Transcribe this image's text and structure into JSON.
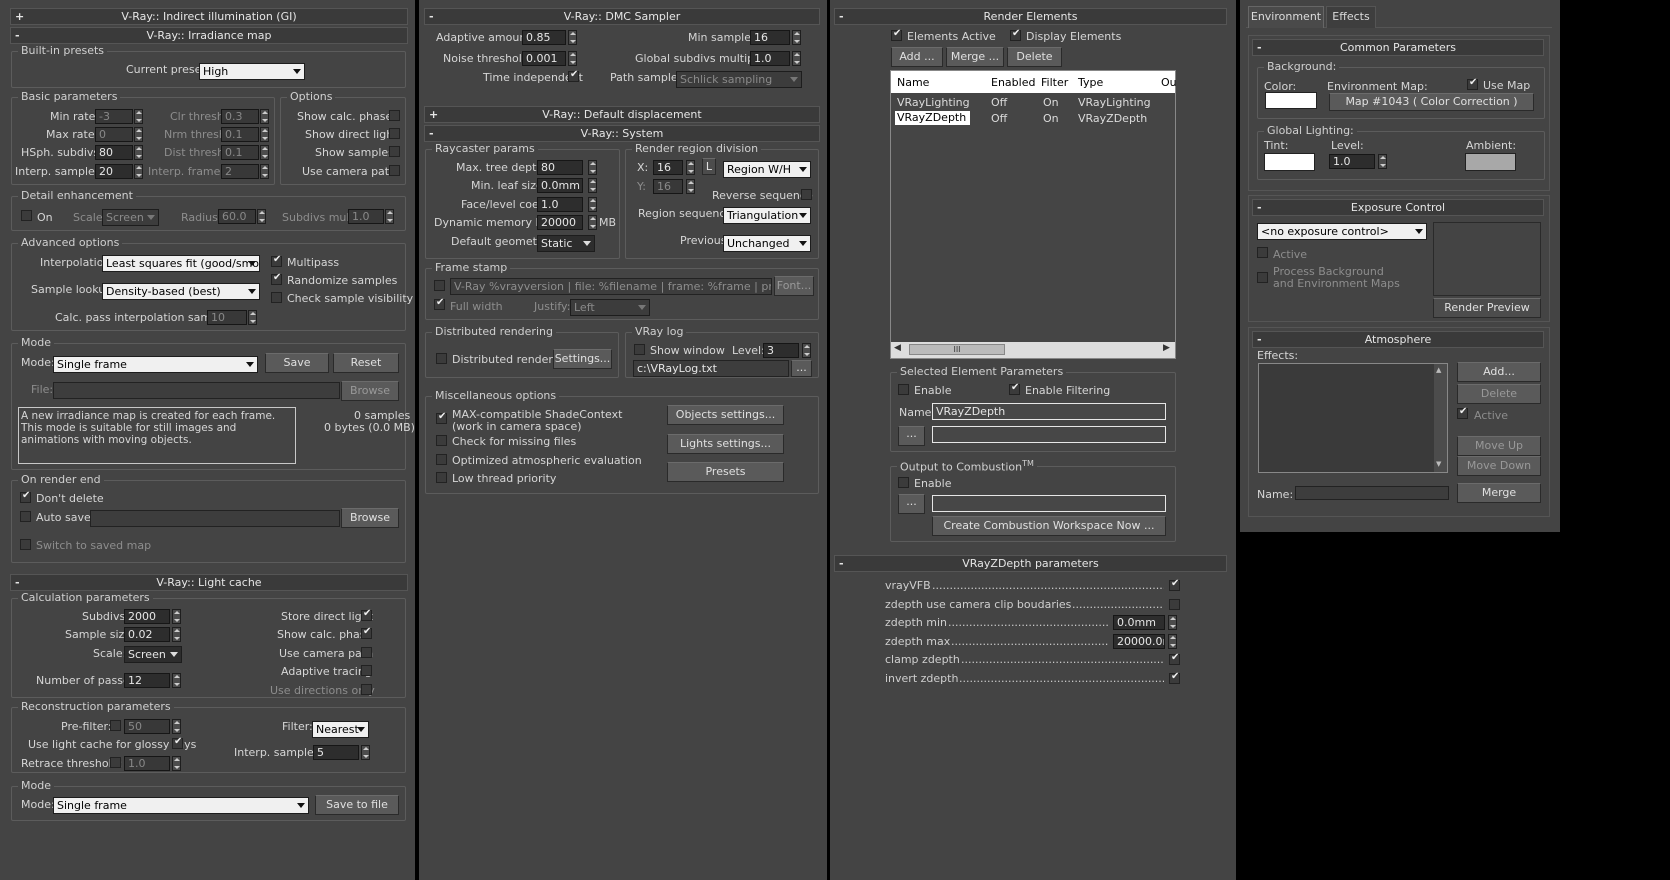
{
  "gi": {
    "title": "V-Ray:: Indirect illumination (GI)",
    "sign": "+"
  },
  "irr": {
    "title": "V-Ray:: Irradiance map",
    "sign": "-",
    "presets": {
      "label": "Built-in presets",
      "current_label": "Current preset:",
      "current": "High"
    },
    "basic": {
      "label": "Basic parameters",
      "min_rate_l": "Min rate:",
      "min_rate": "-3",
      "max_rate_l": "Max rate:",
      "max_rate": "0",
      "hsph_l": "HSph. subdivs:",
      "hsph": "80",
      "interp_l": "Interp. samples:",
      "interp": "20",
      "clr_l": "Clr thresh:",
      "clr": "0.3",
      "nrm_l": "Nrm thresh:",
      "nrm": "0.1",
      "dist_l": "Dist thresh:",
      "dist": "0.1",
      "frames_l": "Interp. frames:",
      "frames": "2"
    },
    "options": {
      "label": "Options",
      "show_calc": "Show calc. phase",
      "show_direct": "Show direct light",
      "show_samples": "Show samples",
      "use_cam": "Use camera path"
    },
    "detail": {
      "label": "Detail enhancement",
      "on": "On",
      "scale_l": "Scale:",
      "scale": "Screen",
      "radius_l": "Radius:",
      "radius": "60.0",
      "subdivs_l": "Subdivs mult.",
      "subdivs": "1.0"
    },
    "adv": {
      "label": "Advanced options",
      "interp_l": "Interpolation",
      "interp": "Least squares fit (good/smooth",
      "lookup_l": "Sample lookup:",
      "lookup": "Density-based (best)",
      "calc_l": "Calc. pass interpolation samples:",
      "calc": "10",
      "multipass": "Multipass",
      "randomize": "Randomize samples",
      "check_vis": "Check sample visibility"
    },
    "mode": {
      "label": "Mode",
      "mode_l": "Mode:",
      "mode": "Single frame",
      "save": "Save",
      "reset": "Reset",
      "file_l": "File:",
      "browse": "Browse",
      "desc": "A new irradiance map is created for each frame.\nThis mode is suitable for still images and animations with moving objects.",
      "samples": "0 samples",
      "bytes": "0 bytes (0.0 MB)"
    },
    "end": {
      "label": "On render end",
      "dont_delete": "Don't delete",
      "auto_save": "Auto save:",
      "browse": "Browse",
      "switch": "Switch to saved map"
    }
  },
  "lc": {
    "title": "V-Ray:: Light cache",
    "sign": "-",
    "calc": {
      "label": "Calculation parameters",
      "subdivs_l": "Subdivs:",
      "subdivs": "2000",
      "size_l": "Sample size:",
      "size": "0.02",
      "scale_l": "Scale:",
      "scale": "Screen",
      "passes_l": "Number of passes:",
      "passes": "12",
      "store_direct": "Store direct light",
      "show_calc": "Show calc. phase",
      "use_cam": "Use camera path",
      "adaptive": "Adaptive tracing",
      "use_dir": "Use directions only"
    },
    "recon": {
      "label": "Reconstruction parameters",
      "prefilter_l": "Pre-filter:",
      "prefilter": "50",
      "glossy": "Use light cache for glossy rays",
      "retrace_l": "Retrace threshold:",
      "retrace": "1.0",
      "filter_l": "Filter:",
      "filter": "Nearest",
      "interp_l": "Interp. samples:",
      "interp": "5"
    },
    "mode": {
      "label": "Mode",
      "mode_l": "Mode:",
      "mode": "Single frame",
      "save": "Save to file"
    }
  },
  "dmc": {
    "title": "V-Ray:: DMC Sampler",
    "sign": "-",
    "adaptive_l": "Adaptive amount:",
    "adaptive": "0.85",
    "noise_l": "Noise threshold:",
    "noise": "0.001",
    "time_l": "Time independent",
    "min_l": "Min samples:",
    "min": "16",
    "global_l": "Global subdivs multiplier:",
    "global": "1.0",
    "path_l": "Path sampler:",
    "path": "Schlick sampling"
  },
  "disp": {
    "title": "V-Ray:: Default displacement",
    "sign": "+"
  },
  "sys": {
    "title": "V-Ray:: System",
    "sign": "-",
    "ray": {
      "label": "Raycaster params",
      "depth_l": "Max. tree depth:",
      "depth": "80",
      "leaf_l": "Min. leaf size:",
      "leaf": "0.0mm",
      "face_l": "Face/level coef.",
      "face": "1.0",
      "mem_l": "Dynamic memory limit:",
      "mem": "20000",
      "mb": "MB",
      "geom_l": "Default geometry:",
      "geom": "Static"
    },
    "region": {
      "label": "Render region division",
      "x_l": "X:",
      "x": "16",
      "y_l": "Y:",
      "y": "16",
      "l": "L",
      "div": "Region W/H",
      "reverse": "Reverse sequence",
      "seq_l": "Region sequence:",
      "seq": "Triangulation",
      "prev_l": "Previous",
      "prev": "Unchanged"
    },
    "stamp": {
      "label": "Frame stamp",
      "text": "V-Ray %vrayversion | file: %filename | frame: %frame | primitives: %",
      "font": "Font...",
      "full": "Full width",
      "justify_l": "Justify:",
      "justify": "Left"
    },
    "dist": {
      "label": "Distributed rendering",
      "check": "Distributed rendering",
      "settings": "Settings..."
    },
    "log": {
      "label": "VRay log",
      "show": "Show window",
      "level_l": "Level:",
      "level": "3",
      "path": "c:\\VRayLog.txt",
      "more": "..."
    },
    "misc": {
      "label": "Miscellaneous options",
      "maxcompat": "MAX-compatible ShadeContext",
      "maxcompat2": "(work in camera space)",
      "missing": "Check for missing files",
      "optimized": "Optimized atmospheric evaluation",
      "low": "Low thread priority",
      "objects": "Objects settings...",
      "lights": "Lights settings...",
      "presets": "Presets"
    }
  },
  "re": {
    "title": "Render Elements",
    "sign": "-",
    "active": "Elements Active",
    "display": "Display Elements",
    "add": "Add ...",
    "merge": "Merge ...",
    "delete": "Delete",
    "columns": [
      "Name",
      "Enabled",
      "Filter",
      "Type",
      "Ou"
    ],
    "rows": [
      [
        "VRayLighting",
        "Off",
        "On",
        "VRayLighting"
      ],
      [
        "VRayZDepth",
        "Off",
        "On",
        "VRayZDepth"
      ]
    ],
    "scroll": "III",
    "sel": {
      "label": "Selected Element Parameters",
      "enable": "Enable",
      "filtering": "Enable Filtering",
      "name_l": "Name:",
      "name": "VRayZDepth",
      "dots": "..."
    },
    "comb": {
      "label": "Output to Combustion",
      "tm": "TM",
      "enable": "Enable",
      "dots": "...",
      "create": "Create Combustion Workspace Now ..."
    }
  },
  "zd": {
    "title": "VRayZDepth parameters",
    "sign": "-",
    "rows": [
      {
        "label": "vrayVFB",
        "kind": "check",
        "on": true
      },
      {
        "label": "zdepth use camera clip boudaries",
        "kind": "check",
        "on": false
      },
      {
        "label": "zdepth min",
        "kind": "num",
        "value": "0.0mm"
      },
      {
        "label": "zdepth max",
        "kind": "num",
        "value": "20000.0m"
      },
      {
        "label": "clamp zdepth",
        "kind": "check",
        "on": true
      },
      {
        "label": "invert zdepth",
        "kind": "check",
        "on": true
      }
    ]
  },
  "env": {
    "tabs": [
      "Environment",
      "Effects"
    ],
    "common": {
      "title": "Common Parameters",
      "sign": "-",
      "bg_l": "Background:",
      "color_l": "Color:",
      "map_l": "Environment Map:",
      "use_map": "Use Map",
      "map": "Map #1043  ( Color Correction )",
      "gl_l": "Global Lighting:",
      "tint_l": "Tint:",
      "level_l": "Level:",
      "level": "1.0",
      "ambient_l": "Ambient:"
    },
    "exposure": {
      "title": "Exposure Control",
      "sign": "-",
      "select": "<no exposure control>",
      "active": "Active",
      "process": "Process Background",
      "process2": "and Environment Maps",
      "preview": "Render Preview"
    },
    "atmo": {
      "title": "Atmosphere",
      "sign": "-",
      "effects_l": "Effects:",
      "add": "Add...",
      "delete": "Delete",
      "active": "Active",
      "up": "Move Up",
      "down": "Move Down",
      "name_l": "Name:",
      "merge": "Merge"
    }
  }
}
